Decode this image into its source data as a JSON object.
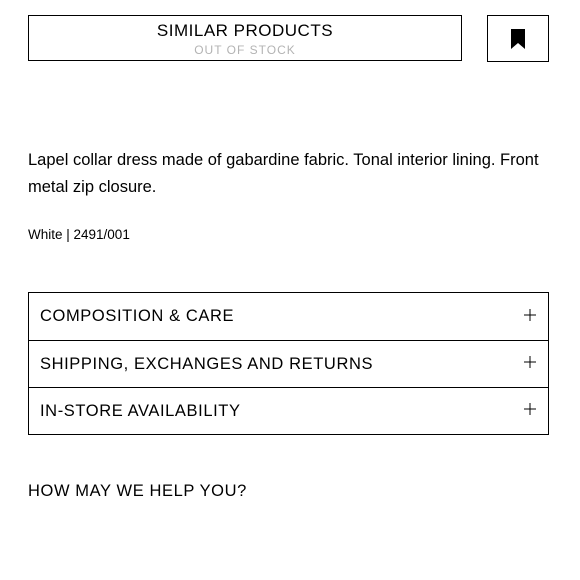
{
  "similar_products": {
    "label": "SIMILAR PRODUCTS",
    "status": "OUT OF STOCK"
  },
  "bookmark": {
    "icon": "bookmark-icon"
  },
  "product": {
    "description": "Lapel collar dress made of gabardine fabric. Tonal interior lining. Front metal zip closure.",
    "color_ref": "White | 2491/001"
  },
  "accordion": {
    "items": [
      {
        "label": "COMPOSITION & CARE",
        "icon": "plus-icon"
      },
      {
        "label": "SHIPPING, EXCHANGES AND RETURNS",
        "icon": "plus-icon"
      },
      {
        "label": "IN-STORE AVAILABILITY",
        "icon": "plus-icon"
      }
    ]
  },
  "help": {
    "label": "HOW MAY WE HELP YOU?"
  },
  "colors": {
    "text": "#000000",
    "muted": "#b3b3b3",
    "background": "#ffffff"
  }
}
